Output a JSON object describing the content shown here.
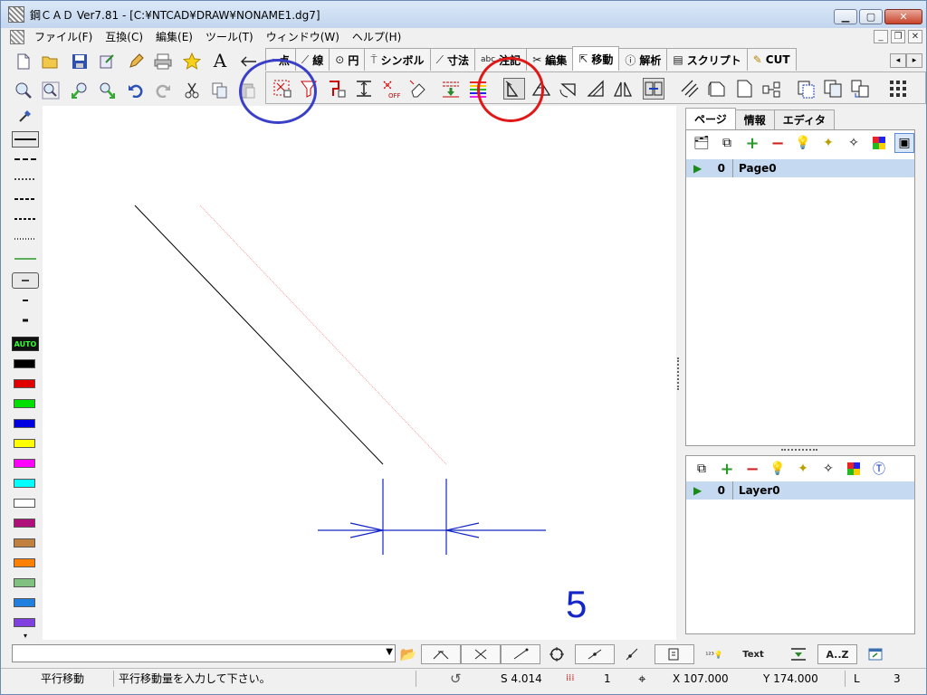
{
  "window": {
    "title": "鋼ＣＡＤ Ver7.81 - [C:¥NTCAD¥DRAW¥NONAME1.dg7]",
    "minimize_icon": "minimize-icon",
    "maximize_icon": "maximize-icon",
    "close_icon": "close-icon"
  },
  "menubar": {
    "items": [
      "ファイル(F)",
      "互換(C)",
      "編集(E)",
      "ツール(T)",
      "ウィンドウ(W)",
      "ヘルプ(H)"
    ]
  },
  "toolbar": {
    "row1_icons": [
      "new-file-icon",
      "open-folder-icon",
      "save-icon",
      "export-icon",
      "edit-pencil-icon",
      "print-icon",
      "favorite-star-icon",
      "text-a-icon",
      "back-arrow-icon"
    ],
    "row2_icons": [
      "zoom-window-icon",
      "zoom-fit-icon",
      "zoom-in-icon",
      "zoom-out-icon",
      "undo-icon",
      "redo-icon",
      "cut-icon",
      "copy-icon",
      "paste-icon"
    ],
    "text_button_label": "A"
  },
  "tabs": [
    {
      "label": "点",
      "icon": "point-icon"
    },
    {
      "label": "線",
      "icon": "line-icon"
    },
    {
      "label": "円",
      "icon": "circle-icon"
    },
    {
      "label": "シンボル",
      "icon": "symbol-icon"
    },
    {
      "label": "寸法",
      "icon": "dimension-icon"
    },
    {
      "label": "注記",
      "icon": "annotation-icon",
      "prefix": "abc"
    },
    {
      "label": "編集",
      "icon": "edit-icon"
    },
    {
      "label": "移動",
      "icon": "move-icon",
      "active": true
    },
    {
      "label": "解析",
      "icon": "info-icon"
    },
    {
      "label": "スクリプト",
      "icon": "script-icon"
    },
    {
      "label": "CUT",
      "icon": "cut-tab-icon"
    }
  ],
  "tab_scroll": {
    "left": "◂",
    "right": "▸"
  },
  "move_tools": [
    "select-window-icon",
    "filter-icon",
    "select-chain-icon",
    "vertical-dim-icon",
    "snap-off-icon",
    "eraser-icon",
    "layer-select-icon",
    "color-select-icon",
    "parallel-move-icon",
    "rotate-copy-icon",
    "rotate-icon",
    "scale-icon",
    "mirror-icon",
    "align-icon",
    "offset-icon",
    "page-copy-icon",
    "page-icon",
    "connect-icon",
    "move-group-icon",
    "copy-group-icon",
    "array-icon",
    "grid-icon"
  ],
  "left_palette": {
    "auto_label": "AUTO",
    "colors": [
      "#000000",
      "#e00000",
      "#00e000",
      "#0000e0",
      "#ffff00",
      "#ff00ff",
      "#00ffff",
      "#ffffff",
      "#b0107a",
      "#c08040",
      "#ff8000",
      "#80c080",
      "#2080e0",
      "#8040e0"
    ]
  },
  "canvas": {
    "dimension_value": "5",
    "line_color": "#000000",
    "preview_color": "#f0a0a0",
    "dimension_color": "#1426c8"
  },
  "right_panel": {
    "tabs": [
      "ページ",
      "情報",
      "エディタ"
    ],
    "active_tab": "ページ",
    "page_tools": [
      "page-properties-icon",
      "page-duplicate-icon",
      "add-icon",
      "remove-icon",
      "visible-icon",
      "show-all-icon",
      "hide-all-icon",
      "color-palette-icon",
      "single-page-icon"
    ],
    "page_row": {
      "number": "0",
      "name": "Page0"
    },
    "layer_tools": [
      "layer-duplicate-icon",
      "add-icon",
      "remove-icon",
      "visible-icon",
      "show-all-icon",
      "hide-all-icon",
      "color-palette-icon",
      "text-layer-icon"
    ],
    "layer_row": {
      "number": "0",
      "name": "Layer0"
    }
  },
  "bottom_toolbar": {
    "combo_value": "",
    "icons": [
      "folder-icon",
      "snap-endpoint-icon",
      "snap-intersection-icon",
      "snap-line-icon",
      "snap-center-icon",
      "snap-midpoint-icon",
      "snap-nearest-icon",
      "snap-dialog-icon",
      "numeric-input-icon",
      "text-snap-icon",
      "layer-down-icon",
      "sort-icon",
      "window-icon"
    ],
    "text_snap_label": "Text",
    "sort_label": "A..Z"
  },
  "statusbar": {
    "mode": "平行移動",
    "message": "平行移動量を入力して下さい。",
    "scale": "S 4.014",
    "grid": "1",
    "x": "X 107.000",
    "y": "Y 174.000",
    "layer_label": "L",
    "layer_value": "3"
  },
  "highlights": {
    "blue_circle_color": "#3a3fc8",
    "red_circle_color": "#e01818"
  }
}
